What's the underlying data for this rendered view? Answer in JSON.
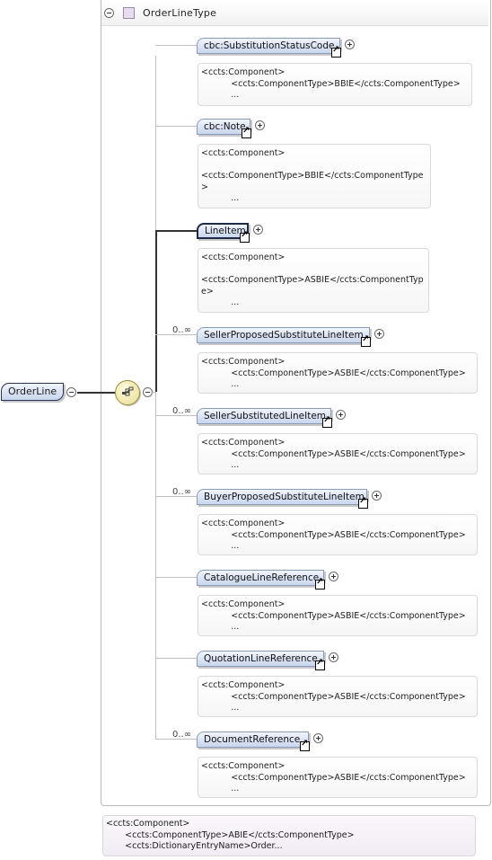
{
  "root": {
    "label": "OrderLine"
  },
  "type": {
    "title": "OrderLineType"
  },
  "elements": [
    {
      "label": "cbc:SubstitutionStatusCode",
      "cardinality": "",
      "doc": "<ccts:Component>\n           <ccts:ComponentType>BBIE</ccts:ComponentType>\n           ..."
    },
    {
      "label": "cbc:Note",
      "cardinality": "",
      "doc": "<ccts:Component>\n\n<ccts:ComponentType>BBIE</ccts:ComponentType\n>\n           ..."
    },
    {
      "label": "LineItem",
      "cardinality": "",
      "doc": "<ccts:Component>\n\n<ccts:ComponentType>ASBIE</ccts:ComponentTyp\ne>\n           ..."
    },
    {
      "label": "SellerProposedSubstituteLineItem",
      "cardinality": "0..∞",
      "doc": "<ccts:Component>\n           <ccts:ComponentType>ASBIE</ccts:ComponentType>\n           ..."
    },
    {
      "label": "SellerSubstitutedLineItem",
      "cardinality": "0..∞",
      "doc": "<ccts:Component>\n           <ccts:ComponentType>ASBIE</ccts:ComponentType>\n           ..."
    },
    {
      "label": "BuyerProposedSubstituteLineItem",
      "cardinality": "0..∞",
      "doc": "<ccts:Component>\n           <ccts:ComponentType>ASBIE</ccts:ComponentType>\n           ..."
    },
    {
      "label": "CatalogueLineReference",
      "cardinality": "",
      "doc": "<ccts:Component>\n           <ccts:ComponentType>ASBIE</ccts:ComponentType>\n           ..."
    },
    {
      "label": "QuotationLineReference",
      "cardinality": "",
      "doc": "<ccts:Component>\n           <ccts:ComponentType>ASBIE</ccts:ComponentType>\n           ..."
    },
    {
      "label": "DocumentReference",
      "cardinality": "0..∞",
      "doc": "<ccts:Component>\n           <ccts:ComponentType>ASBIE</ccts:ComponentType>\n           ..."
    }
  ],
  "bottom_doc": "<ccts:Component>\n       <ccts:ComponentType>ABIE</ccts:ComponentType>\n       <ccts:DictionaryEntryName>Order..."
}
